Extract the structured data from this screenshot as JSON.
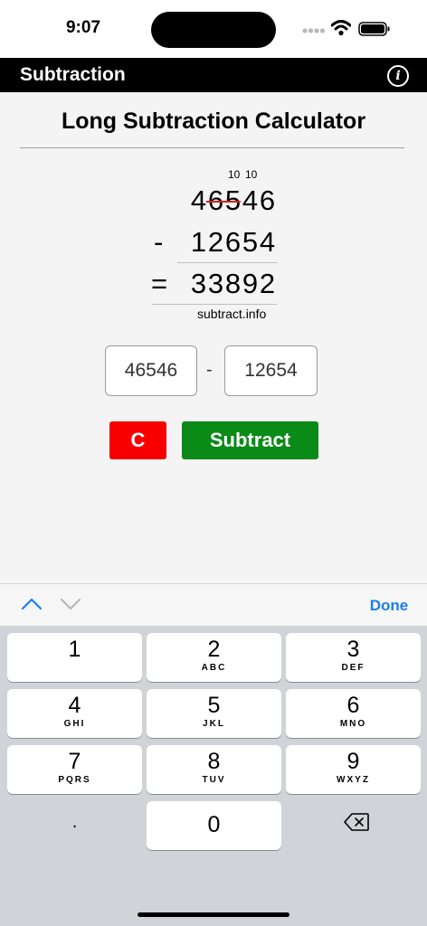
{
  "status_bar": {
    "time": "9:07"
  },
  "nav": {
    "title": "Subtraction",
    "info_icon": "i"
  },
  "main": {
    "title": "Long Subtraction Calculator",
    "borrows": [
      "10",
      "10"
    ],
    "minuend_digits": [
      "4",
      "6",
      "5",
      "4",
      "6"
    ],
    "subtrahend_digits": [
      "1",
      "2",
      "6",
      "5",
      "4"
    ],
    "result_digits": [
      "3",
      "3",
      "8",
      "9",
      "2"
    ],
    "minus_sign": "-",
    "equals_sign": "=",
    "watermark": "subtract.info",
    "input_minuend": "46546",
    "input_subtrahend": "12654",
    "input_separator": "-",
    "clear_label": "C",
    "subtract_label": "Subtract",
    "colors": {
      "clear": "#f90000",
      "subtract": "#0a8a17",
      "strike": "#d92020"
    }
  },
  "accessory": {
    "done_label": "Done",
    "prev_icon": "chevron-up-icon",
    "next_icon": "chevron-down-icon"
  },
  "keyboard": {
    "keys": [
      {
        "digit": "1",
        "letters": ""
      },
      {
        "digit": "2",
        "letters": "ABC"
      },
      {
        "digit": "3",
        "letters": "DEF"
      },
      {
        "digit": "4",
        "letters": "GHI"
      },
      {
        "digit": "5",
        "letters": "JKL"
      },
      {
        "digit": "6",
        "letters": "MNO"
      },
      {
        "digit": "7",
        "letters": "PQRS"
      },
      {
        "digit": "8",
        "letters": "TUV"
      },
      {
        "digit": "9",
        "letters": "WXYZ"
      },
      {
        "digit": "0",
        "letters": ""
      }
    ],
    "decimal": ".",
    "backspace_icon": "backspace-icon"
  }
}
